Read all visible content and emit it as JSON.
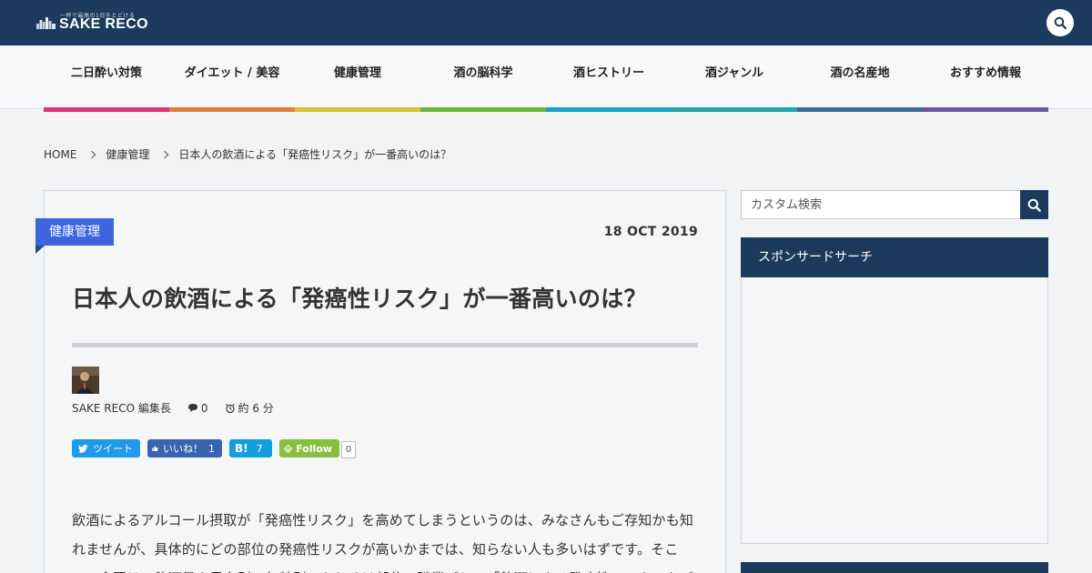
{
  "header": {
    "logo_tagline": "一杯で最高の1日をとどける",
    "logo_name": "SAKE RECO",
    "search_icon": "search-icon",
    "bg_color": "#1c3a5e"
  },
  "nav": {
    "items": [
      {
        "label": "二日酔い対策",
        "color": "#e0327a"
      },
      {
        "label": "ダイエット / 美容",
        "color": "#ea7a3c"
      },
      {
        "label": "健康管理",
        "color": "#d7c234"
      },
      {
        "label": "酒の脳科学",
        "color": "#6cb33a"
      },
      {
        "label": "酒ヒストリー",
        "color": "#13a3c8"
      },
      {
        "label": "酒ジャンル",
        "color": "#1fa7a9"
      },
      {
        "label": "酒の名産地",
        "color": "#3d68a3"
      },
      {
        "label": "おすすめ情報",
        "color": "#6a56a8"
      }
    ]
  },
  "breadcrumb": {
    "home": "HOME",
    "category": "健康管理",
    "current": "日本人の飲酒による「発癌性リスク」が一番高いのは？"
  },
  "article": {
    "category": "健康管理",
    "category_color": "#3c65e0",
    "date": "18 OCT 2019",
    "title": "日本人の飲酒による「発癌性リスク」が一番高いのは？",
    "author": "SAKE RECO 編集長",
    "comments": "0",
    "read_time": "約 6 分",
    "share": {
      "tweet": "ツイート",
      "like": "いいね！",
      "like_count": "1",
      "hatena": "B!",
      "hatena_count": "7",
      "follow": "Follow",
      "follow_count": "0"
    },
    "body": "飲酒によるアルコール摂取が「発癌性リスク」を高めてしまうというのは、みなさんもご存知かも知れませんが、具体的にどの部位の発癌性リスクが高いかまでは、知らない人も多いはずです。そこで、今回は、飲酒量や男女別、年齢別、もしくは部位、職業ごとの「飲酒による発癌性リスク」をご"
  },
  "sidebar": {
    "search_placeholder": "カスタム検索",
    "widget_title": "スポンサードサーチ"
  }
}
